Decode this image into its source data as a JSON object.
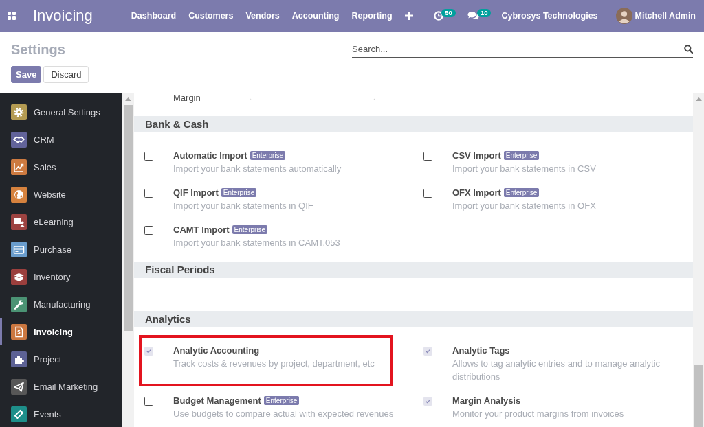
{
  "navbar": {
    "app_name": "Invoicing",
    "menu": [
      "Dashboard",
      "Customers",
      "Vendors",
      "Accounting",
      "Reporting"
    ],
    "activity_count": "50",
    "message_count": "10",
    "company": "Cybrosys Technologies",
    "user": "Mitchell Admin"
  },
  "control_panel": {
    "title": "Settings",
    "search": {
      "placeholder": "Search..."
    },
    "buttons": [
      {
        "label": "Save",
        "kind": "primary"
      },
      {
        "label": "Discard",
        "kind": "secondary"
      }
    ]
  },
  "sidebar": {
    "items": [
      {
        "label": "General Settings",
        "color": "#b49b52",
        "selected": false
      },
      {
        "label": "CRM",
        "color": "#62639a",
        "selected": false
      },
      {
        "label": "Sales",
        "color": "#cd7a40",
        "selected": false
      },
      {
        "label": "Website",
        "color": "#d6823e",
        "selected": false
      },
      {
        "label": "eLearning",
        "color": "#9d4341",
        "selected": false
      },
      {
        "label": "Purchase",
        "color": "#6a9dcd",
        "selected": false
      },
      {
        "label": "Inventory",
        "color": "#9b3f3d",
        "selected": false
      },
      {
        "label": "Manufacturing",
        "color": "#4b9374",
        "selected": false
      },
      {
        "label": "Invoicing",
        "color": "#cb7740",
        "selected": true
      },
      {
        "label": "Project",
        "color": "#5d6295",
        "selected": false
      },
      {
        "label": "Email Marketing",
        "color": "#575757",
        "selected": false
      },
      {
        "label": "Events",
        "color": "#1e8f8a",
        "selected": false
      }
    ]
  },
  "settings": {
    "partial_row": {
      "label": "Margin"
    },
    "sections": [
      {
        "title": "Bank & Cash",
        "items": [
          {
            "title": "Automatic Import",
            "badge": "Enterprise",
            "description": "Import your bank statements automatically",
            "checked": false,
            "highlighted": false
          },
          {
            "title": "CSV Import",
            "badge": "Enterprise",
            "description": "Import your bank statements in CSV",
            "checked": false,
            "highlighted": false
          },
          {
            "title": "QIF Import",
            "badge": "Enterprise",
            "description": "Import your bank statements in QIF",
            "checked": false,
            "highlighted": false
          },
          {
            "title": "OFX Import",
            "badge": "Enterprise",
            "description": "Import your bank statements in OFX",
            "checked": false,
            "highlighted": false
          },
          {
            "title": "CAMT Import",
            "badge": "Enterprise",
            "description": "Import your bank statements in CAMT.053",
            "checked": false,
            "highlighted": false
          }
        ]
      },
      {
        "title": "Fiscal Periods"
      },
      {
        "title": "Analytics",
        "items": [
          {
            "title": "Analytic Accounting",
            "description": "Track costs & revenues by project, department, etc",
            "checked": true,
            "highlighted": true
          },
          {
            "title": "Analytic Tags",
            "description": "Allows to tag analytic entries and to manage analytic distributions",
            "checked": true,
            "highlighted": false
          },
          {
            "title": "Budget Management",
            "badge": "Enterprise",
            "description": "Use budgets to compare actual with expected revenues",
            "checked": false,
            "highlighted": false
          },
          {
            "title": "Margin Analysis",
            "description": "Monitor your product margins from invoices",
            "checked": true,
            "highlighted": false
          }
        ]
      }
    ]
  }
}
